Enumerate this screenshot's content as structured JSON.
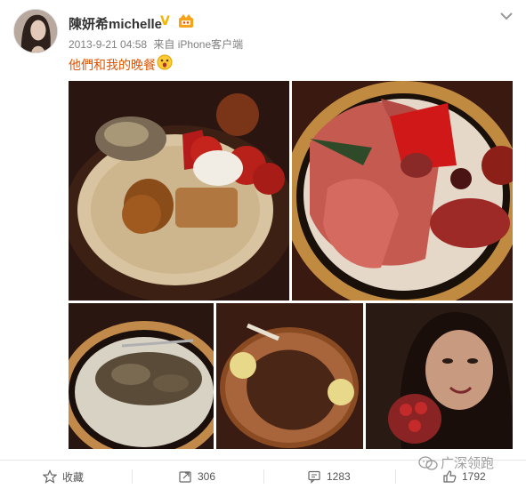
{
  "post": {
    "username": "陳妍希michelle",
    "timestamp": "2013-9-21 04:58",
    "source": "来自 iPhone客户端",
    "text": "他們和我的晚餐",
    "verified": "verified-v-icon",
    "vip_badge": "vip-crown-icon",
    "emoji": "surprised-emoji-icon"
  },
  "photos": [
    {
      "name": "appetizer-plate-photo"
    },
    {
      "name": "cured-meat-platter-photo"
    },
    {
      "name": "mushroom-dish-photo"
    },
    {
      "name": "steak-photo"
    },
    {
      "name": "selfie-photo"
    }
  ],
  "actions": {
    "favorite_label": "收藏",
    "share_count": "306",
    "comment_count": "1283",
    "like_count": "1792"
  },
  "watermark": {
    "text": "广深领跑"
  },
  "colors": {
    "accent_text": "#e05500",
    "meta_text": "#808080",
    "verified": "#f5b400"
  }
}
